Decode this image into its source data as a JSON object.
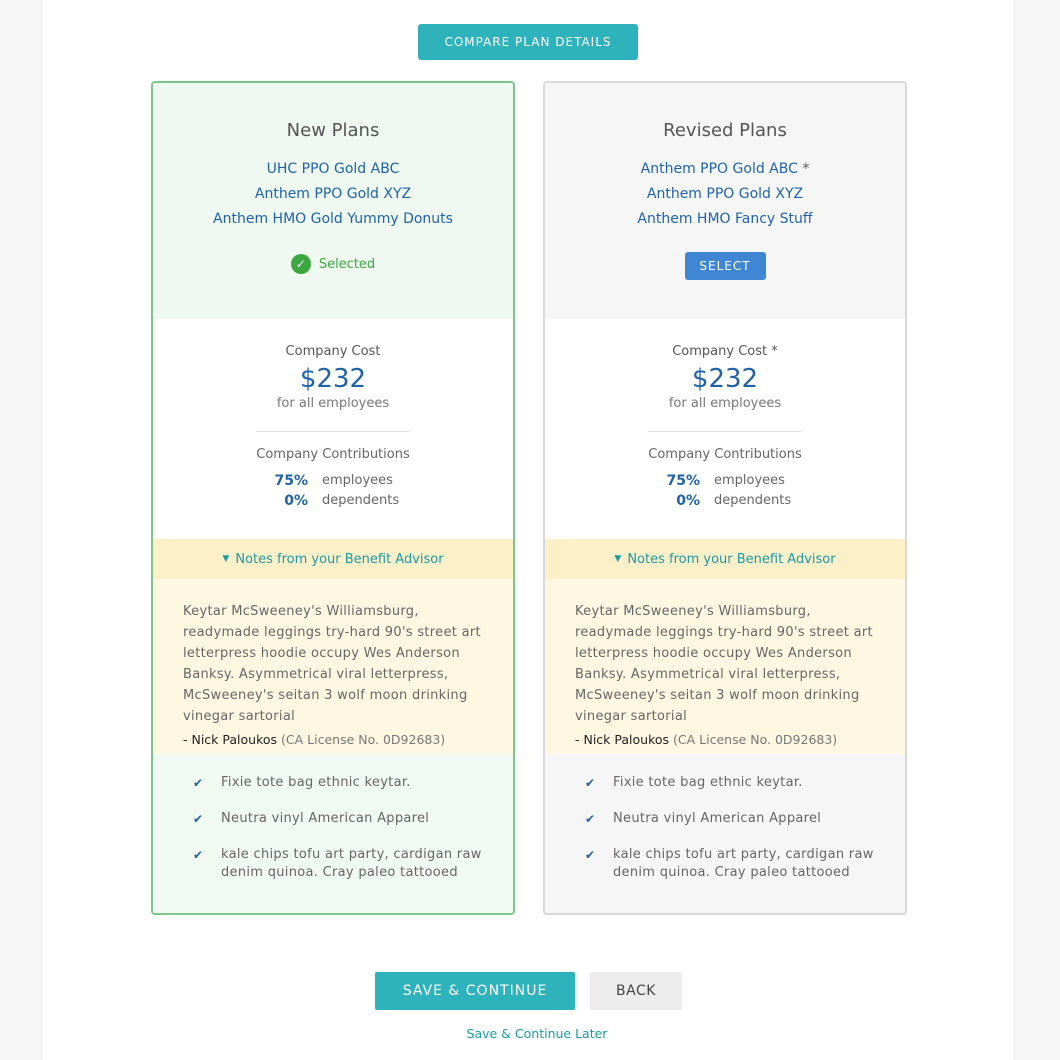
{
  "compare_button": "COMPARE PLAN DETAILS",
  "cards": [
    {
      "title": "New Plans",
      "plans": [
        "UHC PPO Gold ABC",
        "Anthem PPO Gold XYZ",
        "Anthem HMO Gold Yummy Donuts"
      ],
      "status": "Selected",
      "cost_label": "Company Cost",
      "cost_value": "$232",
      "cost_sub": "for all employees",
      "contrib_label": "Company Contributions",
      "contrib": [
        {
          "pct": "75%",
          "label": "employees"
        },
        {
          "pct": "0%",
          "label": "dependents"
        }
      ],
      "notes_header": "Notes from your Benefit Advisor",
      "notes_text": "Keytar McSweeney's Williamsburg, readymade leggings try-hard 90's street art letterpress hoodie occupy Wes Anderson Banksy. Asymmetrical viral letterpress, McSweeney's seitan 3 wolf moon drinking vinegar sartorial",
      "advisor_name": "- Nick Paloukos",
      "advisor_license": "(CA License No. 0D92683)",
      "features": [
        "Fixie tote bag ethnic keytar.",
        "Neutra vinyl American Apparel",
        "kale chips tofu art party, cardigan raw denim quinoa. Cray paleo tattooed"
      ]
    },
    {
      "title": "Revised Plans",
      "plans": [
        "Anthem PPO Gold ABC",
        "Anthem PPO Gold XYZ",
        "Anthem HMO Fancy Stuff"
      ],
      "plan_asterisk": "*",
      "select_button": "SELECT",
      "cost_label": "Company Cost",
      "cost_asterisk": "*",
      "cost_value": "$232",
      "cost_sub": "for all employees",
      "contrib_label": "Company Contributions",
      "contrib": [
        {
          "pct": "75%",
          "label": "employees"
        },
        {
          "pct": "0%",
          "label": "dependents"
        }
      ],
      "notes_header": "Notes from your Benefit Advisor",
      "notes_text": "Keytar McSweeney's Williamsburg, readymade leggings try-hard 90's street art letterpress hoodie occupy Wes Anderson Banksy. Asymmetrical viral letterpress, McSweeney's seitan 3 wolf moon drinking vinegar sartorial",
      "advisor_name": "- Nick Paloukos",
      "advisor_license": "(CA License No. 0D92683)",
      "features": [
        "Fixie tote bag ethnic keytar.",
        "Neutra vinyl American Apparel",
        "kale chips tofu art party, cardigan raw denim quinoa. Cray paleo tattooed"
      ]
    }
  ],
  "footer": {
    "save_button": "SAVE & CONTINUE",
    "back_button": "BACK",
    "later_link": "Save & Continue Later"
  },
  "icons": {
    "check": "check-circle-icon",
    "tick": "checkmark-icon",
    "triangle": "caret-down-icon"
  },
  "colors": {
    "teal": "#2eb3bd",
    "blue_link": "#1f63a6",
    "green": "#3aa83f",
    "select_blue": "#3f87d3"
  }
}
